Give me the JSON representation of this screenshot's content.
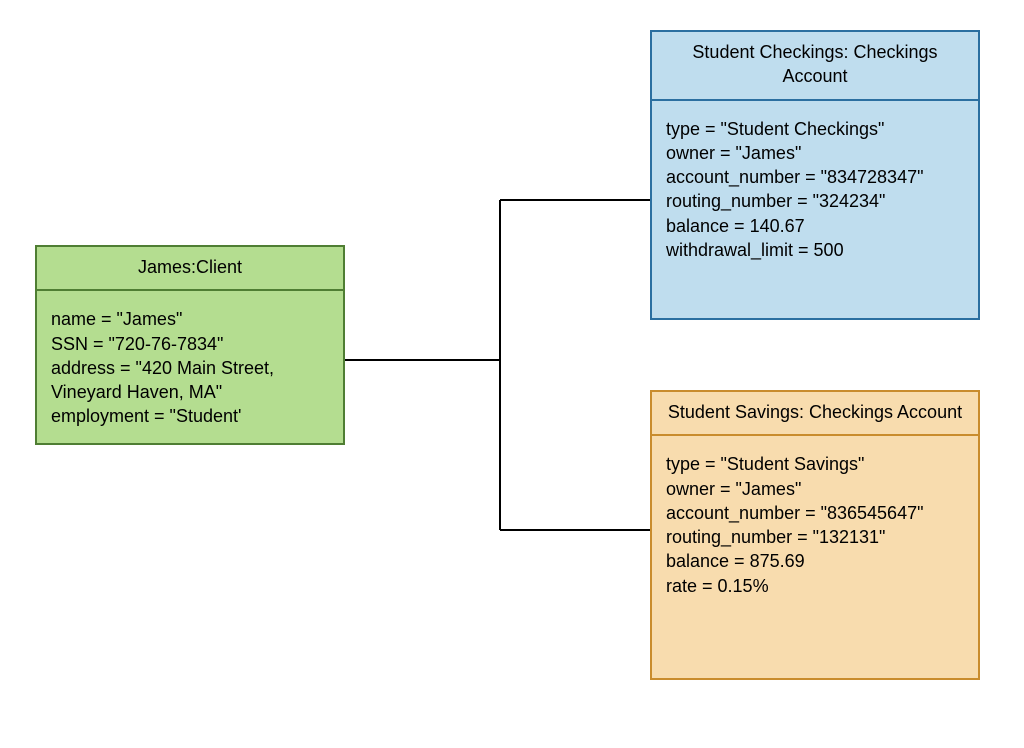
{
  "client": {
    "title": "James:Client",
    "attrs": {
      "name": "name = \"James\"",
      "ssn": "SSN = \"720-76-7834\"",
      "address": "address = \"420 Main Street, Vineyard Haven, MA\"",
      "employment": "employment = \"Student'"
    }
  },
  "checkings": {
    "title": "Student Checkings: Checkings Account",
    "attrs": {
      "type": "type = \"Student Checkings\"",
      "owner": "owner = \"James\"",
      "account_number": "account_number = \"834728347\"",
      "routing_number": "routing_number = \"324234\"",
      "balance": "balance = 140.67",
      "withdrawal_limit": "withdrawal_limit = 500"
    }
  },
  "savings": {
    "title": "Student Savings: Checkings Account",
    "attrs": {
      "type": "type = \"Student Savings\"",
      "owner": "owner = \"James\"",
      "account_number": "account_number = \"836545647\"",
      "routing_number": "routing_number = \"132131\"",
      "balance": "balance = 875.69",
      "rate": "rate = 0.15%"
    }
  }
}
